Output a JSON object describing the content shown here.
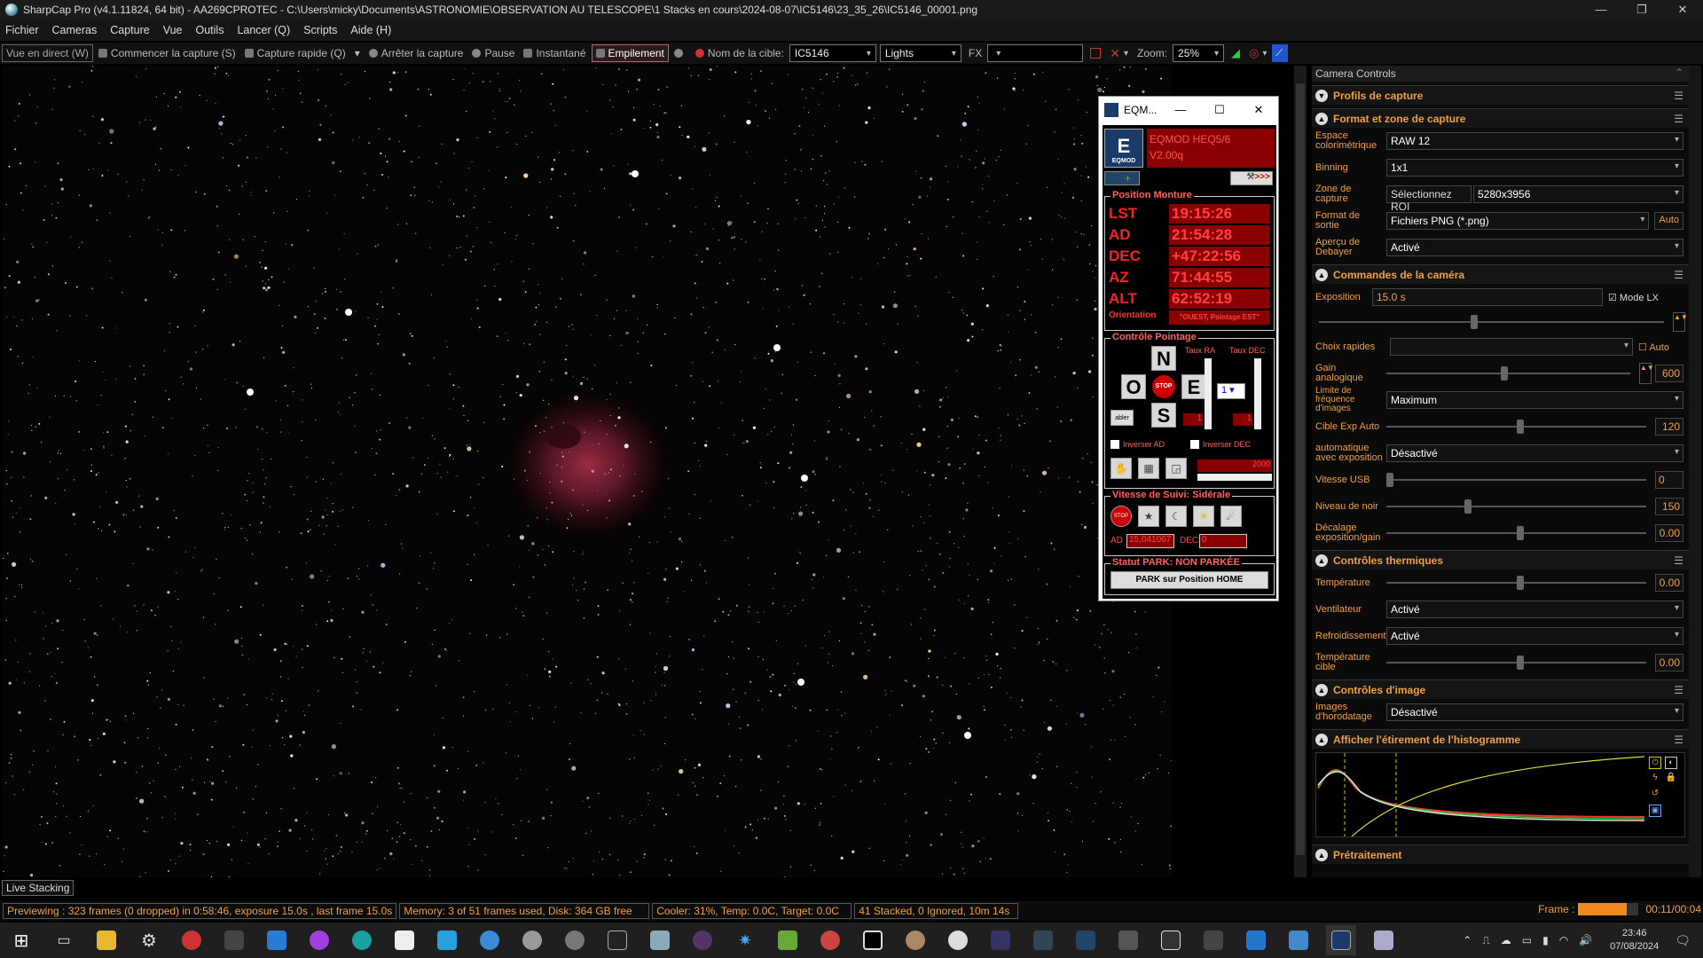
{
  "window": {
    "title": "SharpCap Pro (v4.1.11824, 64 bit) - AA269CPROTEC - C:\\Users\\micky\\Documents\\ASTRONOMIE\\OBSERVATION AU TELESCOPE\\1 Stacks en cours\\2024-08-07\\IC5146\\23_35_26\\IC5146_00001.png",
    "minimize": "—",
    "restore": "❐",
    "close": "✕"
  },
  "menu": [
    "Fichier",
    "Cameras",
    "Capture",
    "Vue",
    "Outils",
    "Lancer (Q)",
    "Scripts",
    "Aide (H)"
  ],
  "toolbar": {
    "live_view": "Vue en direct (W)",
    "start_capture": "Commencer la capture (S)",
    "quick_capture": "Capture rapide (Q)",
    "stop_capture": "Arrêter la capture",
    "pause": "Pause",
    "snapshot": "Instantané",
    "stacking": "Empilement",
    "target_label": "Nom de la cible:",
    "target_value": "IC5146",
    "frame_type": "Lights",
    "fx_label": "FX",
    "fx_value": "",
    "zoom_label": "Zoom:",
    "zoom_value": "25%"
  },
  "live_stacking": "Live Stacking",
  "status": {
    "preview": "Previewing : 323 frames (0 dropped) in 0:58:46, exposure 15.0s , last frame 15.0s",
    "memory": "Memory: 3 of 51 frames used, Disk: 364 GB free",
    "cooler": "Cooler: 31%, Temp: 0.0C, Target: 0.0C",
    "stacked": "41 Stacked, 0 Ignored, 10m 14s",
    "frame_label": "Frame :",
    "frame_time": "00:11/00:04",
    "frame_progress": 0.8
  },
  "eqmod": {
    "title": "EQM...",
    "logo": "E",
    "logo_caption": "EQMOD",
    "mount_line1": "EQMOD HEQ5/6",
    "mount_line2": "V2.00q",
    "tools_btn": ">>>",
    "position_title": "Position Monture",
    "lst_k": "LST",
    "lst_v": "19:15:26",
    "ad_k": "AD",
    "ad_v": "21:54:28",
    "dec_k": "DEC",
    "dec_v": "+47:22:56",
    "az_k": "AZ",
    "az_v": "71:44:55",
    "alt_k": "ALT",
    "alt_v": "62:52:19",
    "orient_k": "Orientation",
    "orient_v": "\"OUEST, Pointage EST\"",
    "slew_title": "Contrôle Pointage",
    "rate_ra": "Taux RA",
    "rate_dec": "Taux DEC",
    "north": "N",
    "south": "S",
    "west": "O",
    "east": "E",
    "stop": "STOP",
    "abtn": "abler",
    "rate_value": "1",
    "ra_rate_num": "1",
    "dec_rate_num": "1",
    "invert_ra": "Inverser AD",
    "invert_dec": "Inverser DEC",
    "rate_slider_value": "2000",
    "track_title": "Vitesse de Suivi: Sidérale",
    "ad_label": "AD",
    "ad_rate": "15,041067",
    "dec_label": "DEC",
    "dec_rate": "0",
    "park_status": "Statut PARK: NON PARKÉE",
    "park_btn": "PARK sur Position HOME"
  },
  "panel": {
    "header": "Camera Controls",
    "capture_profiles": "Profils de capture",
    "format_section": "Format et zone de capture",
    "color_space_label": "Espace colorimétrique",
    "color_space": "RAW 12",
    "binning_label": "Binning",
    "binning": "1x1",
    "zone_label": "Zone de capture",
    "roi_btn": "Sélectionnez ROI",
    "zone": "5280x3956",
    "format_label": "Format de sortie",
    "format": "Fichiers PNG (*.png)",
    "auto_btn": "Auto",
    "debayer_label": "Aperçu de Debayer",
    "debayer": "Activé",
    "camera_cmds": "Commandes de la caméra",
    "exposure_label": "Exposition",
    "exposure": "15.0 s",
    "lx_mode": "Mode LX",
    "quick_choice": "Choix rapides",
    "quick_auto": "Auto",
    "gain_label": "Gain analogique",
    "gain": "600",
    "fps_label": "Limite de fréquence d'images",
    "fps": "Maximum",
    "target_exp_label": "Cible Exp Auto",
    "target_exp": "120",
    "auto_exp_label": "automatique avec exposition",
    "auto_exp": "Désactivé",
    "usb_label": "Vitesse USB",
    "usb": "0",
    "black_label": "Niveau de noir",
    "black": "150",
    "offset_label": "Décalage exposition/gain",
    "offset": "0.00",
    "thermal": "Contrôles thermiques",
    "temp_label": "Température",
    "temp": "0.00",
    "fan_label": "Ventilateur",
    "fan": "Activé",
    "cooling_label": "Refroidissement",
    "cooling": "Activé",
    "target_temp_label": "Température cible",
    "target_temp": "0.00",
    "image_ctrl": "Contrôles d'image",
    "timestamp_label": "Images d'horodatage",
    "timestamp": "Désactivé",
    "histogram": "Afficher l'étirement de l'histogramme",
    "preprocessing": "Prétraitement"
  },
  "clock": {
    "time": "23:46",
    "date": "07/08/2024"
  },
  "colors": {
    "accent": "#f0a040",
    "eq_red": "#8a0000",
    "eq_text": "#ff3030"
  }
}
